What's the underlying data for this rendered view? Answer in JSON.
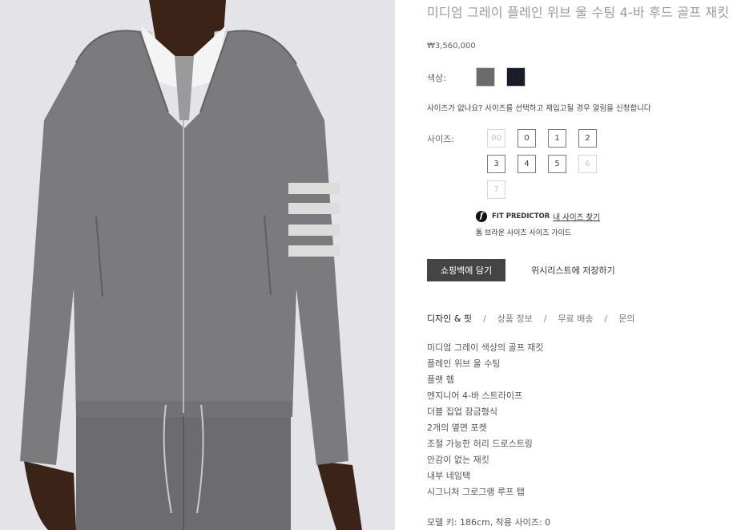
{
  "product": {
    "title": "미디엄 그레이 플레인 위브 울 수팅 4-바 후드 골프 재킷",
    "price": "₩3,560,000",
    "color_label": "색상:",
    "swatches": [
      {
        "name": "grey",
        "color": "#6a6b6d"
      },
      {
        "name": "navy",
        "color": "#1b1c2b"
      }
    ],
    "notify_text": "사이즈가 없나요? 사이즈를 선택하고 재입고될 경우 알림을 신청합니다",
    "size_label": "사이즈:",
    "sizes": [
      {
        "label": "00",
        "available": false
      },
      {
        "label": "0",
        "available": true
      },
      {
        "label": "1",
        "available": true
      },
      {
        "label": "2",
        "available": true
      },
      {
        "label": "3",
        "available": true
      },
      {
        "label": "4",
        "available": true
      },
      {
        "label": "5",
        "available": true
      },
      {
        "label": "6",
        "available": false
      },
      {
        "label": "7",
        "available": false
      }
    ],
    "fit_predictor": {
      "logo": "f",
      "name": "FIT PREDICTOR",
      "link": "내 사이즈 찾기"
    },
    "size_guide": "톰 브라운 사이즈 사이즈 가이드",
    "add_to_bag": "쇼핑백에 담기",
    "add_to_wishlist": "위시리스트에 저장하기",
    "tabs": [
      {
        "label": "디자인 & 핏",
        "active": true
      },
      {
        "label": "상품 정보",
        "active": false
      },
      {
        "label": "무료 배송",
        "active": false
      },
      {
        "label": "문의",
        "active": false
      }
    ],
    "tab_separator": "/",
    "features": [
      "미디엄 그레이 색상의 골프 재킷",
      "플레인 위브 울 수팅",
      "플랫 헴",
      "엔지니어 4-바 스트라이프",
      "더블 집업 잠금형식",
      "2개의 옆면 포켓",
      "조절 가능한 허리 드로스트링",
      "안감이 없는 재킷",
      "내부 네임택",
      "시그니처 그로그랭 루프 탭"
    ],
    "model_info": "모델 키: 186cm, 착용 사이즈: 0"
  }
}
